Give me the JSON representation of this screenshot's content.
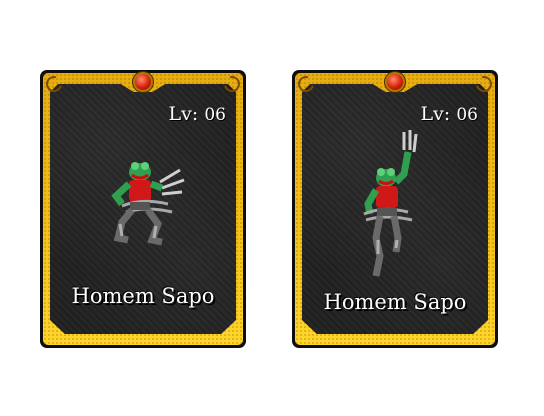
{
  "cards": [
    {
      "level_label": "Lv:",
      "level_value": "06",
      "name": "Homem Sapo",
      "pose": "crouch"
    },
    {
      "level_label": "Lv:",
      "level_value": "06",
      "name": "Homem Sapo",
      "pose": "claw-raised"
    }
  ],
  "colors": {
    "frame": "#f2c018",
    "inner": "#262626",
    "gem": "#d8200c",
    "text": "#ffffff"
  }
}
